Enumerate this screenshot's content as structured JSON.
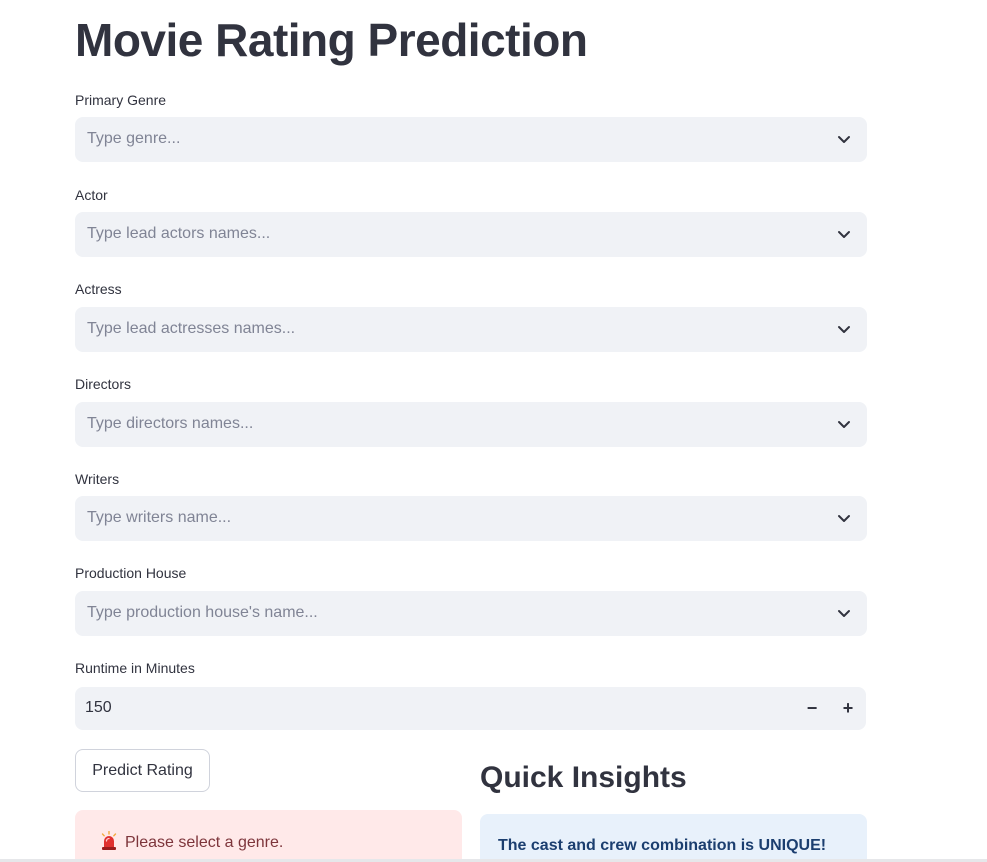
{
  "page": {
    "title": "Movie Rating Prediction"
  },
  "form": {
    "genre": {
      "label": "Primary Genre",
      "placeholder": "Type genre..."
    },
    "actor": {
      "label": "Actor",
      "placeholder": "Type lead actors names..."
    },
    "actress": {
      "label": "Actress",
      "placeholder": "Type lead actresses names..."
    },
    "directors": {
      "label": "Directors",
      "placeholder": "Type directors names..."
    },
    "writers": {
      "label": "Writers",
      "placeholder": "Type writers name..."
    },
    "production_house": {
      "label": "Production House",
      "placeholder": "Type production house's name..."
    },
    "runtime": {
      "label": "Runtime in Minutes",
      "value": "150",
      "decrement_symbol": "−",
      "increment_symbol": "+"
    }
  },
  "actions": {
    "predict_label": "Predict Rating"
  },
  "alerts": {
    "error_text": "Please select a genre.",
    "error_icon": "siren-icon"
  },
  "insights": {
    "heading": "Quick Insights",
    "message": "The cast and crew combination is UNIQUE!"
  },
  "colors": {
    "input_bg": "#f0f2f6",
    "error_bg": "#ffe9e9",
    "error_text": "#7d353b",
    "info_bg": "#e8f1fb",
    "info_text": "#1b3e6f"
  }
}
